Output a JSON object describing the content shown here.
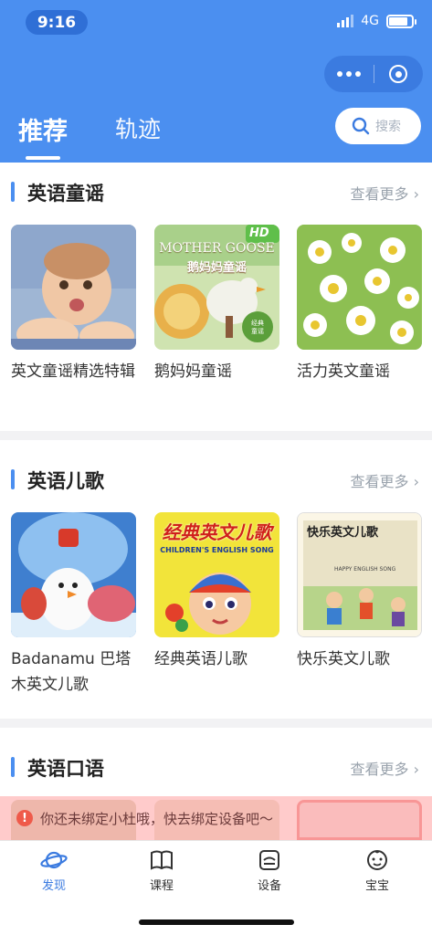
{
  "status": {
    "time": "9:16",
    "network": "4G"
  },
  "header": {
    "tabs": [
      {
        "label": "推荐",
        "active": true
      },
      {
        "label": "轨迹",
        "active": false
      }
    ],
    "search_placeholder": "搜索"
  },
  "sections": [
    {
      "title": "英语童谣",
      "more": "查看更多",
      "items": [
        {
          "label": "英文童谣精选特辑",
          "image": "baby-photo"
        },
        {
          "label": "鹅妈妈童谣",
          "image": "mother-goose-cover",
          "badge": "HD",
          "cover_title": "MOTHER GOOSE",
          "cover_subtitle": "鹅妈妈童谣"
        },
        {
          "label": "活力英文童谣",
          "image": "daisy-flowers"
        }
      ]
    },
    {
      "title": "英语儿歌",
      "more": "查看更多",
      "items": [
        {
          "label": "Badanamu 巴塔木英文儿歌",
          "image": "snowman-characters"
        },
        {
          "label": "经典英语儿歌",
          "image": "classic-songs-cover",
          "cover_title": "经典英文儿歌",
          "cover_subtitle": "CHILDREN'S ENGLISH SONG"
        },
        {
          "label": "快乐英文儿歌",
          "image": "happy-songs-cover",
          "cover_title": "快乐英文儿歌",
          "cover_subtitle": "HAPPY ENGLISH SONG"
        }
      ]
    },
    {
      "title": "英语口语",
      "more": "查看更多",
      "items": []
    }
  ],
  "notice": {
    "text": "你还未绑定小杜哦，快去绑定设备吧～"
  },
  "tabbar": [
    {
      "label": "发现",
      "icon": "planet-icon",
      "active": true
    },
    {
      "label": "课程",
      "icon": "book-icon",
      "active": false
    },
    {
      "label": "设备",
      "icon": "device-icon",
      "active": false
    },
    {
      "label": "宝宝",
      "icon": "baby-face-icon",
      "active": false
    }
  ],
  "colors": {
    "primary": "#4b8ff0",
    "accent_bar": "#4b8ff0",
    "notice_bg": "#ffb3b3"
  }
}
